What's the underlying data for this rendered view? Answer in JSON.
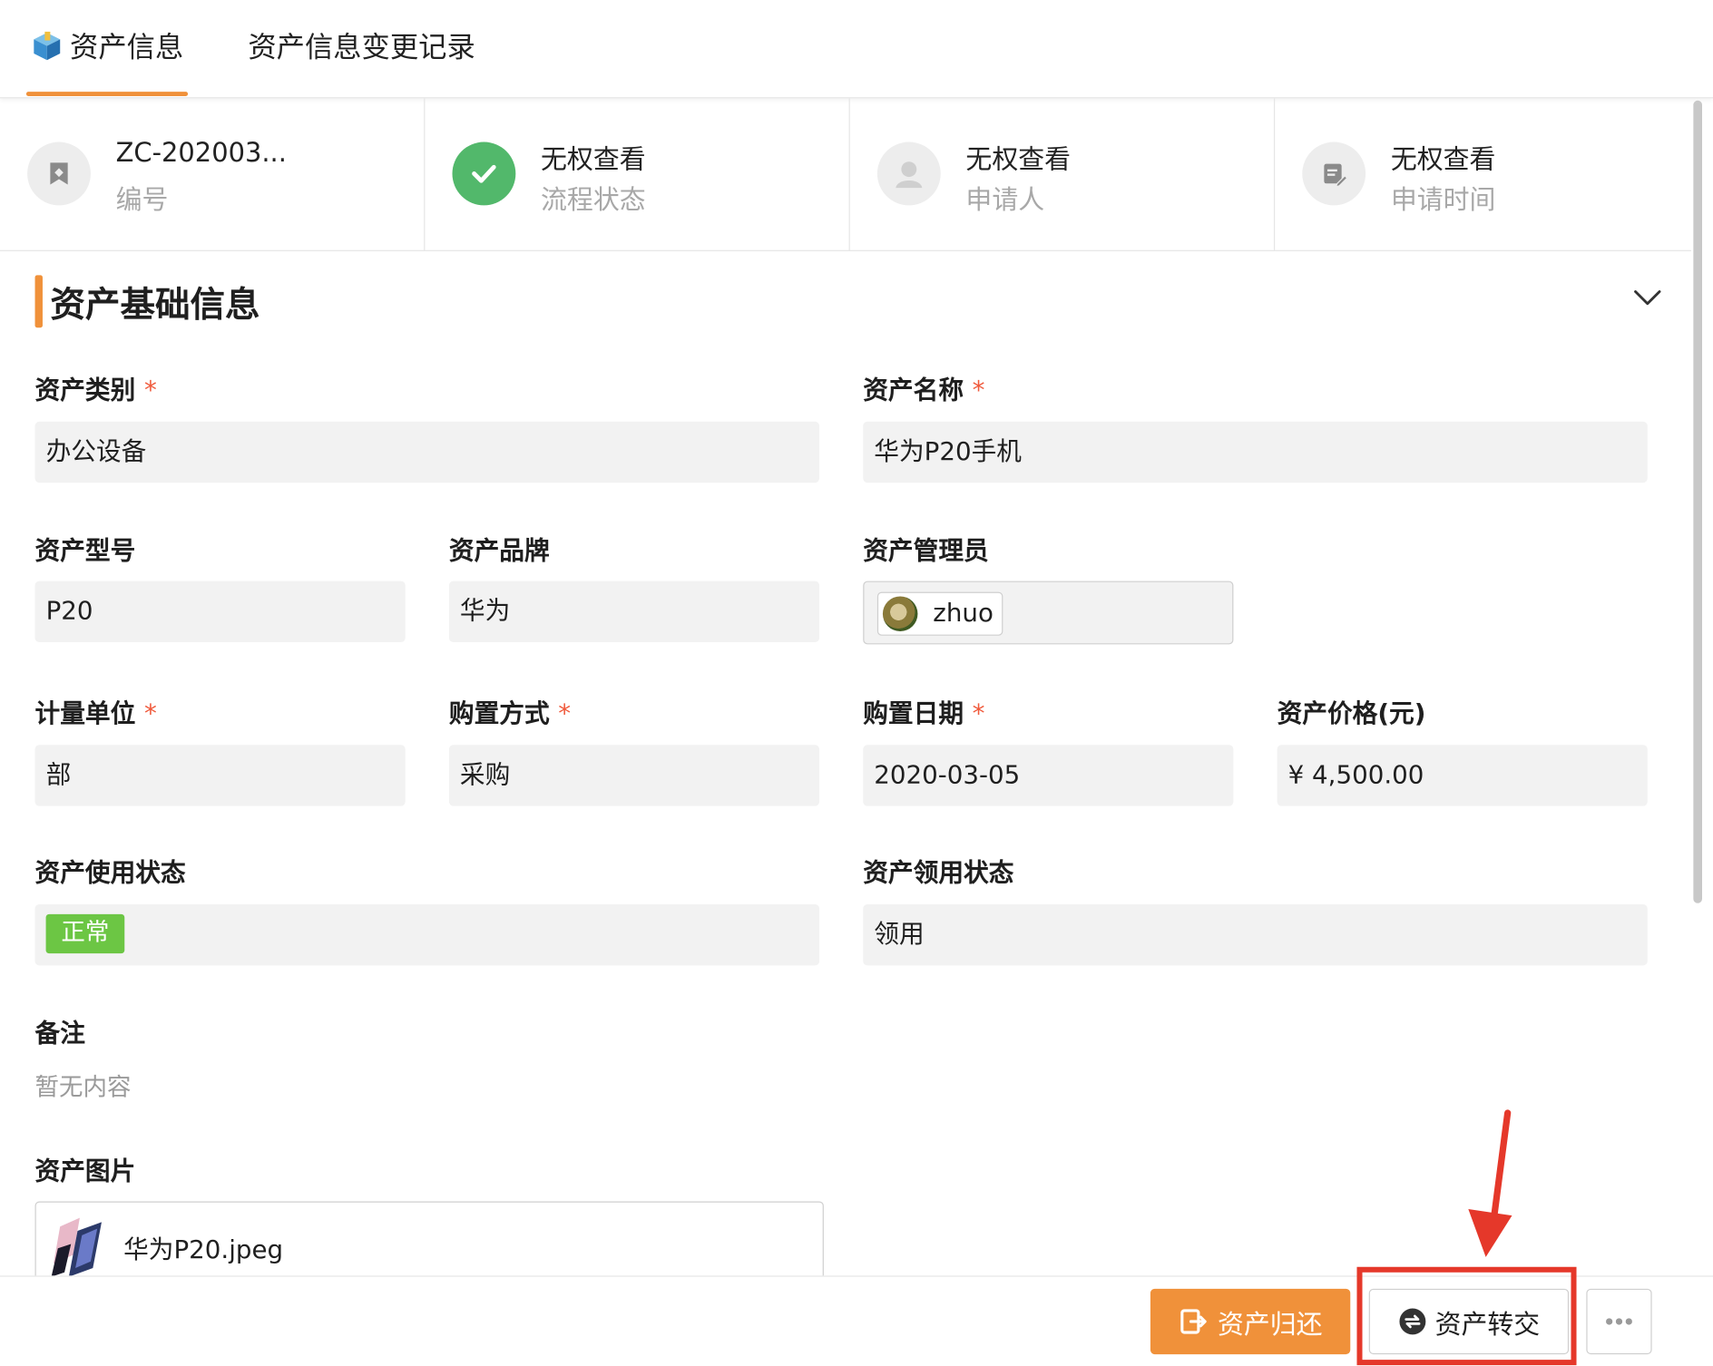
{
  "tabs": [
    {
      "label": "资产信息"
    },
    {
      "label": "资产信息变更记录"
    }
  ],
  "summary": [
    {
      "value": "ZC-202003...",
      "label": "编号",
      "icon": "tag-icon"
    },
    {
      "value": "无权查看",
      "label": "流程状态",
      "icon": "check-circle-icon"
    },
    {
      "value": "无权查看",
      "label": "申请人",
      "icon": "user-icon"
    },
    {
      "value": "无权查看",
      "label": "申请时间",
      "icon": "edit-note-icon"
    }
  ],
  "section": {
    "title": "资产基础信息"
  },
  "form": {
    "category": {
      "label": "资产类别",
      "value": "办公设备"
    },
    "name": {
      "label": "资产名称",
      "value": "华为P20手机"
    },
    "model": {
      "label": "资产型号",
      "value": "P20"
    },
    "brand": {
      "label": "资产品牌",
      "value": "华为"
    },
    "manager": {
      "label": "资产管理员",
      "value": "zhuo"
    },
    "unit": {
      "label": "计量单位",
      "value": "部"
    },
    "purchase_method": {
      "label": "购置方式",
      "value": "采购"
    },
    "purchase_date": {
      "label": "购置日期",
      "value": "2020-03-05"
    },
    "price": {
      "label": "资产价格(元)",
      "value": "¥ 4,500.00"
    },
    "use_status": {
      "label": "资产使用状态",
      "value": "正常"
    },
    "claim_status": {
      "label": "资产领用状态",
      "value": "领用"
    },
    "remark": {
      "label": "备注",
      "value": "暂无内容"
    },
    "images": {
      "label": "资产图片",
      "file": "华为P20.jpeg"
    },
    "required_mark": "*"
  },
  "footer": {
    "return_label": "资产归还",
    "transfer_label": "资产转交"
  },
  "colors": {
    "accent": "#f0913a",
    "success": "#52b86b",
    "tag_green": "#6cc644",
    "required": "#f05a3c",
    "annotation_red": "#e5382a"
  }
}
